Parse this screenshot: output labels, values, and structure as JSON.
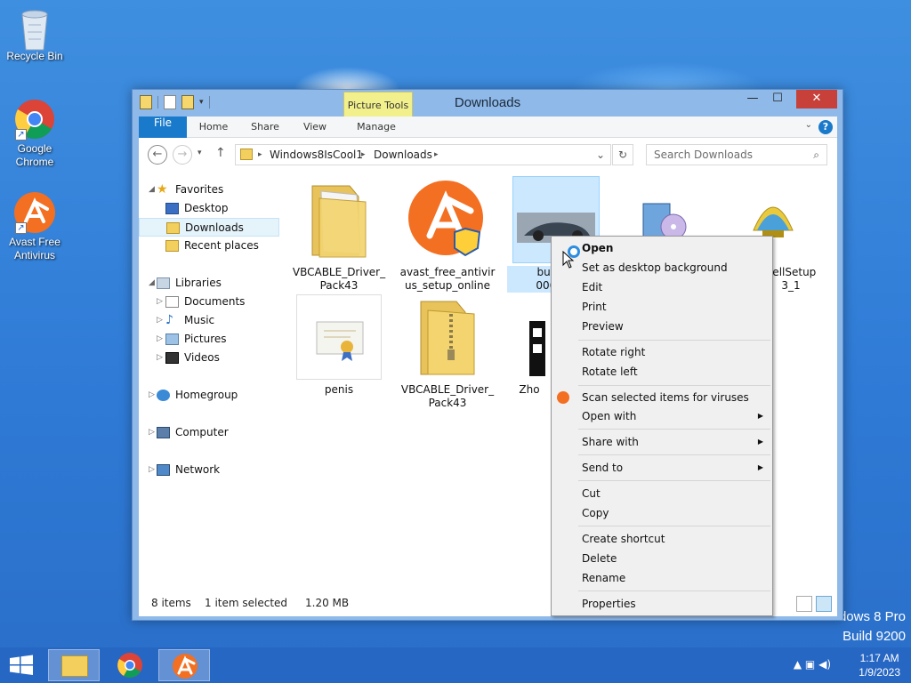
{
  "desktop": {
    "icons": [
      {
        "label": "Recycle Bin",
        "icon": "recycle-bin-icon"
      },
      {
        "label": "Google Chrome",
        "icon": "chrome-icon"
      },
      {
        "label": "Avast Free Antivirus",
        "icon": "avast-icon"
      }
    ],
    "watermark": {
      "line1": "dows 8 Pro",
      "line2": "Build 9200"
    }
  },
  "window": {
    "title": "Downloads",
    "tool_tab": "Picture Tools",
    "controls": {
      "minimize": "—",
      "maximize": "☐",
      "close": "✕"
    },
    "ribbon_tabs": [
      "File",
      "Home",
      "Share",
      "View",
      "Manage"
    ],
    "help": "?",
    "address": {
      "path": [
        "Windows8IsCool1",
        "Downloads"
      ],
      "sep": "▸",
      "dropdown": "⌄",
      "refresh": "↻"
    },
    "search_placeholder": "Search Downloads"
  },
  "nav": {
    "favorites": "Favorites",
    "favorite_items": [
      "Desktop",
      "Downloads",
      "Recent places"
    ],
    "libraries": "Libraries",
    "library_items": [
      "Documents",
      "Music",
      "Pictures",
      "Videos"
    ],
    "homegroup": "Homegroup",
    "computer": "Computer",
    "network": "Network"
  },
  "files": [
    {
      "name1": "VBCABLE_Driver_",
      "name2": "Pack43",
      "icon": "folder-icon"
    },
    {
      "name1": "avast_free_antivir",
      "name2": "us_setup_online",
      "icon": "avast-setup-icon"
    },
    {
      "name1": "bugatti",
      "name2": "006x22",
      "icon": "image-thumbnail-icon"
    },
    {
      "name1": "",
      "name2": "",
      "icon": "installer-disc-icon"
    },
    {
      "name1": "hellSetup",
      "name2": "3_1",
      "icon": "shell-setup-icon"
    },
    {
      "name1": "penis",
      "name2": "",
      "icon": "certificate-icon"
    },
    {
      "name1": "VBCABLE_Driver_",
      "name2": "Pack43",
      "icon": "zip-folder-icon"
    },
    {
      "name1": "Zho",
      "name2": "",
      "icon": "film-icon"
    }
  ],
  "status": {
    "items": "8 items",
    "selected": "1 item selected",
    "size": "1.20 MB"
  },
  "context_menu": {
    "items": [
      "Open",
      "Set as desktop background",
      "Edit",
      "Print",
      "Preview",
      "Rotate right",
      "Rotate left",
      "Scan selected items for viruses",
      "Open with",
      "Share with",
      "Send to",
      "Cut",
      "Copy",
      "Create shortcut",
      "Delete",
      "Rename",
      "Properties"
    ],
    "submenu_arrow": "▶"
  },
  "taskbar": {
    "clock_time": "1:17 AM",
    "clock_date": "1/9/2023",
    "tray": "▲  ▣  ◀)"
  }
}
